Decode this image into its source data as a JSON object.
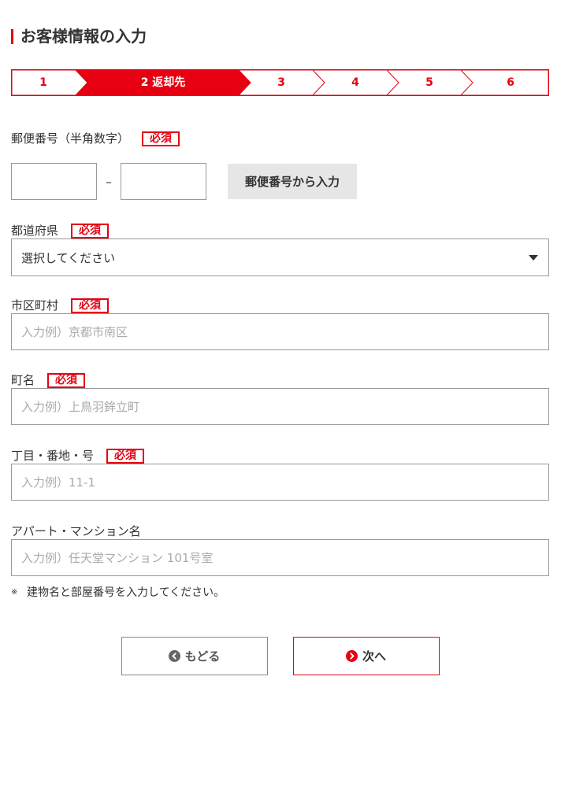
{
  "header": {
    "title": "お客様情報の入力"
  },
  "steps": [
    {
      "label": "1",
      "active": false
    },
    {
      "label": "2 返却先",
      "active": true
    },
    {
      "label": "3",
      "active": false
    },
    {
      "label": "4",
      "active": false
    },
    {
      "label": "5",
      "active": false
    },
    {
      "label": "6",
      "active": false
    }
  ],
  "form": {
    "required_badge": "必須",
    "postal_code": {
      "label": "郵便番号（半角数字）",
      "required": true,
      "first_value": "",
      "second_value": "",
      "separator": "–",
      "lookup_button": "郵便番号から入力"
    },
    "prefecture": {
      "label": "都道府県",
      "required": true,
      "selected": "選択してください",
      "icon": "caret-down-icon"
    },
    "city": {
      "label": "市区町村",
      "required": true,
      "value": "",
      "placeholder": "入力例）京都市南区"
    },
    "town": {
      "label": "町名",
      "required": true,
      "value": "",
      "placeholder": "入力例）上鳥羽鉾立町"
    },
    "address_number": {
      "label": "丁目・番地・号",
      "required": true,
      "value": "",
      "placeholder": "入力例）11-1"
    },
    "building": {
      "label": "アパート・マンション名",
      "required": false,
      "value": "",
      "placeholder": "入力例）任天堂マンション 101号室"
    },
    "note": {
      "mark": "※",
      "text": "建物名と部屋番号を入力してください。"
    }
  },
  "actions": {
    "back": {
      "label": "もどる",
      "icon": "chevron-left-circle-icon"
    },
    "next": {
      "label": "次へ",
      "icon": "chevron-right-circle-icon"
    }
  },
  "colors": {
    "accent": "#e60012",
    "text": "#333333",
    "border": "#999999",
    "placeholder": "#aaaaaa",
    "button_background": "#e6e6e6"
  }
}
